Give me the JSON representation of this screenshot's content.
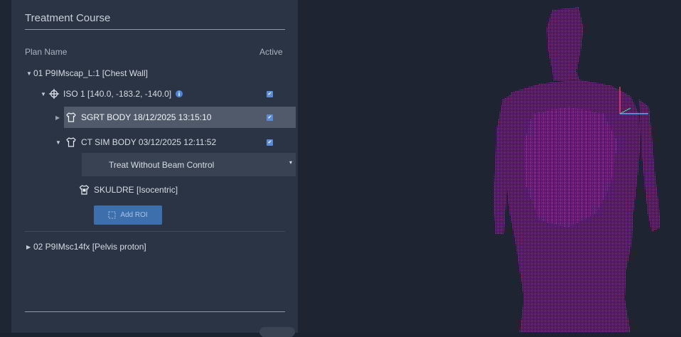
{
  "panel": {
    "title": "Treatment Course",
    "columns": {
      "plan_name": "Plan Name",
      "active": "Active"
    }
  },
  "tree": {
    "plan1_label": "01 P9IMscap_L:1 [Chest Wall]",
    "iso_label": "ISO 1 [140.0, -183.2, -140.0]",
    "sgrt_label": "SGRT BODY 18/12/2025 13:15:10",
    "ctsim_label": "CT SIM BODY 03/12/2025 12:11:52",
    "beam_control_selected": "Treat Without Beam Control",
    "roi_label": "SKULDRE [Isocentric]",
    "add_roi_label": "Add ROI",
    "plan2_label": "02 P9IMsc14fx [Pelvis proton]"
  },
  "colors": {
    "panel_bg": "#2b3444",
    "viewer_bg": "#1e2432",
    "accent_blue": "#3d6fad",
    "checkbox_blue": "#5b8bd6",
    "point_cloud": "#c23bc9",
    "axis_red": "#e0406a",
    "axis_blue": "#5ab0ff"
  },
  "icons": [
    "caret-down-icon",
    "caret-right-icon",
    "isocenter-crosshair-icon",
    "info-icon",
    "body-shirt-icon",
    "roi-shirt-icon",
    "add-roi-icon",
    "checkbox-checked-icon"
  ]
}
